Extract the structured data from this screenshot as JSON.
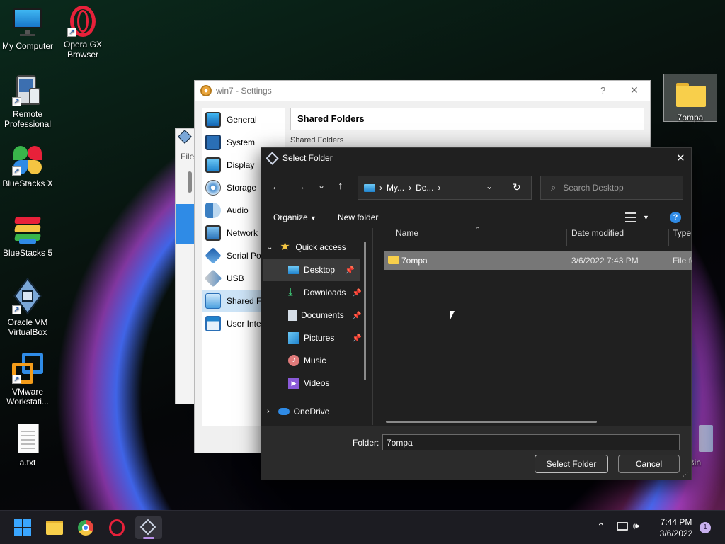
{
  "desktop": {
    "icons": [
      {
        "label": "My Computer"
      },
      {
        "label": "Opera GX Browser"
      },
      {
        "label": "Remote Professional"
      },
      {
        "label": "BlueStacks X"
      },
      {
        "label": "BlueStacks 5"
      },
      {
        "label": "Oracle VM VirtualBox"
      },
      {
        "label": "VMware Workstati..."
      },
      {
        "label": "a.txt"
      },
      {
        "label": "7ompa"
      },
      {
        "label": "le Bin"
      }
    ]
  },
  "vbox_back": {
    "menu": "File"
  },
  "settings": {
    "title": "win7 - Settings",
    "help": "?",
    "close": "✕",
    "header": "Shared Folders",
    "subheader": "Shared Folders",
    "items": [
      {
        "label": "General"
      },
      {
        "label": "System"
      },
      {
        "label": "Display"
      },
      {
        "label": "Storage"
      },
      {
        "label": "Audio"
      },
      {
        "label": "Network"
      },
      {
        "label": "Serial Ports"
      },
      {
        "label": "USB"
      },
      {
        "label": "Shared Folders"
      },
      {
        "label": "User Interface"
      }
    ]
  },
  "dialog": {
    "title": "Select Folder",
    "close": "✕",
    "breadcrumb": [
      "My...",
      "De..."
    ],
    "search_placeholder": "Search Desktop",
    "organize": "Organize",
    "new_folder": "New folder",
    "columns": {
      "name": "Name",
      "date": "Date modified",
      "type": "Type"
    },
    "nav": [
      {
        "label": "Quick access"
      },
      {
        "label": "Desktop",
        "pinned": true
      },
      {
        "label": "Downloads",
        "pinned": true
      },
      {
        "label": "Documents",
        "pinned": true
      },
      {
        "label": "Pictures",
        "pinned": true
      },
      {
        "label": "Music"
      },
      {
        "label": "Videos"
      },
      {
        "label": "OneDrive"
      }
    ],
    "files": [
      {
        "name": "7ompa",
        "date": "3/6/2022 7:43 PM",
        "type": "File fo"
      }
    ],
    "folder_label": "Folder:",
    "folder_value": "7ompa",
    "select_button": "Select Folder",
    "cancel_button": "Cancel"
  },
  "taskbar": {
    "time": "7:44 PM",
    "date": "3/6/2022",
    "notifications": "1"
  },
  "colors": {
    "accent": "#2f8be6",
    "folder": "#f4c542",
    "dialog_bg": "#202020",
    "selection": "#777777"
  }
}
